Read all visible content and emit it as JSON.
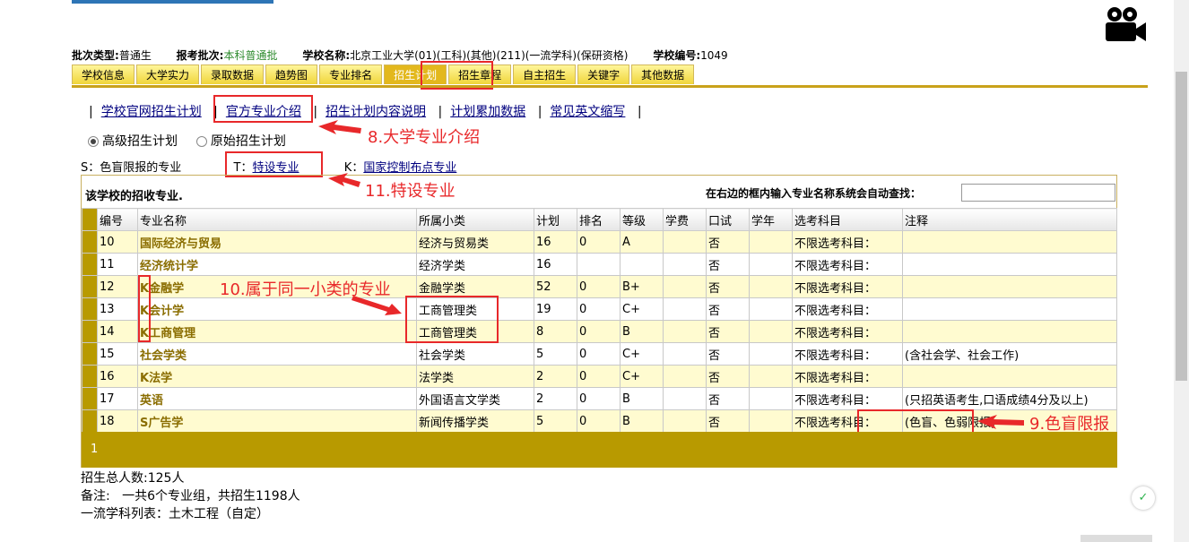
{
  "info": {
    "batch_type_label": "批次类型:",
    "batch_type": "普通生",
    "report_batch_label": "报考批次:",
    "report_batch": "本科普通批",
    "school_name_label": "学校名称:",
    "school_name": "北京工业大学(01)(工科)(其他)(211)(一流学科)(保研资格)",
    "school_code_label": "学校编号:",
    "school_code": "1049"
  },
  "tabs": [
    "学校信息",
    "大学实力",
    "录取数据",
    "趋势图",
    "专业排名",
    "招生计划",
    "招生章程",
    "自主招生",
    "关键字",
    "其他数据"
  ],
  "links": [
    "学校官网招生计划",
    "官方专业介绍",
    "招生计划内容说明",
    "计划累加数据",
    "常见英文缩写"
  ],
  "radios": [
    "高级招生计划",
    "原始招生计划"
  ],
  "legend": {
    "s": "S：色盲限报的专业",
    "t_key": "T：",
    "t_link": "特设专业",
    "k_key": "K：",
    "k_link": "国家控制布点专业"
  },
  "panel": {
    "title": "该学校的招收专业.",
    "search_label": "在右边的框内输入专业名称系统会自动查找："
  },
  "table": {
    "headers": [
      "编号",
      "专业名称",
      "所属小类",
      "计划",
      "排名",
      "等级",
      "学费",
      "口试",
      "学年",
      "选考科目",
      "注释"
    ],
    "rows": [
      [
        "10",
        "国际经济与贸易",
        "经济与贸易类",
        "16",
        "0",
        "A",
        "",
        "否",
        "",
        "不限选考科目：",
        ""
      ],
      [
        "11",
        "经济统计学",
        "经济学类",
        "16",
        "",
        "",
        "",
        "否",
        "",
        "不限选考科目：",
        ""
      ],
      [
        "12",
        "K金融学",
        "金融学类",
        "52",
        "0",
        "B+",
        "",
        "否",
        "",
        "不限选考科目：",
        ""
      ],
      [
        "13",
        "K会计学",
        "工商管理类",
        "19",
        "0",
        "C+",
        "",
        "否",
        "",
        "不限选考科目：",
        ""
      ],
      [
        "14",
        "K工商管理",
        "工商管理类",
        "8",
        "0",
        "B",
        "",
        "否",
        "",
        "不限选考科目：",
        ""
      ],
      [
        "15",
        "社会学类",
        "社会学类",
        "5",
        "0",
        "C+",
        "",
        "否",
        "",
        "不限选考科目：",
        "(含社会学、社会工作)"
      ],
      [
        "16",
        "K法学",
        "法学类",
        "2",
        "0",
        "C+",
        "",
        "否",
        "",
        "不限选考科目：",
        ""
      ],
      [
        "17",
        "英语",
        "外国语言文学类",
        "2",
        "0",
        "B",
        "",
        "否",
        "",
        "不限选考科目：",
        "(只招英语考生,口语成绩4分及以上)"
      ],
      [
        "18",
        "S广告学",
        "新闻传播学类",
        "5",
        "0",
        "B",
        "",
        "否",
        "",
        "不限选考科目：",
        "(色盲、色弱限报)"
      ]
    ]
  },
  "pager": {
    "page": "1"
  },
  "footer": {
    "total": "招生总人数:125人",
    "note": "备注:   一共6个专业组，共招生1198人",
    "first_class": "一流学科列表：土木工程（自定）"
  },
  "annotations": {
    "a8": "8.大学专业介绍",
    "a9": "9.色盲限报",
    "a10": "10.属于同一小类的专业",
    "a11": "11.特设专业"
  },
  "colors": {
    "accent": "#e3b81d",
    "annotation": "#e8282a",
    "link": "#00007f"
  },
  "icons": {
    "camera": "video-camera-icon",
    "float": "check-badge-icon"
  }
}
